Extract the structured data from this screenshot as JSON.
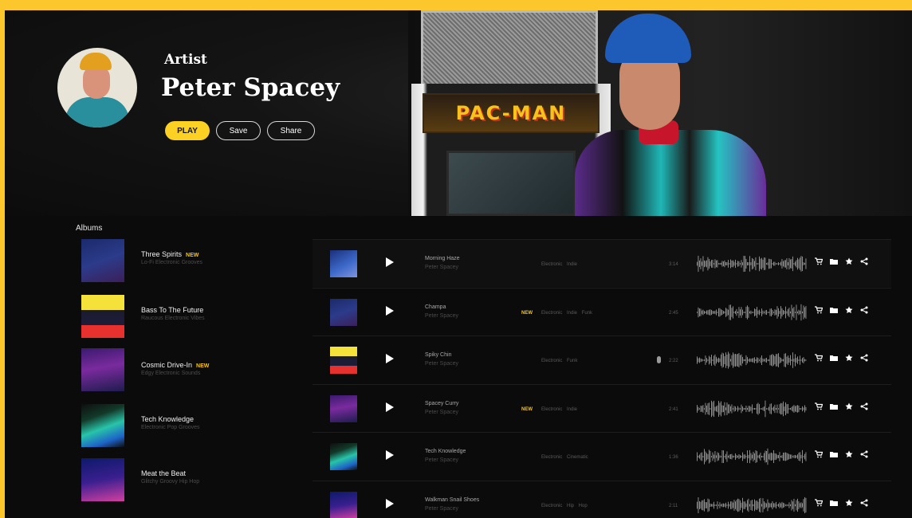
{
  "hero": {
    "label": "Artist",
    "title": "Peter Spacey",
    "play_label": "PLAY",
    "save_label": "Save",
    "share_label": "Share",
    "arcade_marquee": "PAC-MAN"
  },
  "albums": {
    "heading": "Albums",
    "new_badge": "NEW",
    "items": [
      {
        "title": "Three Spirits",
        "subtitle": "Lo-Fi Electronic Grooves",
        "new": true
      },
      {
        "title": "Bass To The Future",
        "subtitle": "Raucous Electronic Vibes",
        "new": false
      },
      {
        "title": "Cosmic Drive-In",
        "subtitle": "Edgy Electronic Sounds",
        "new": true
      },
      {
        "title": "Tech Knowledge",
        "subtitle": "Electronic Pop Grooves",
        "new": false
      },
      {
        "title": "Meat the Beat",
        "subtitle": "Glitchy Groovy Hip Hop",
        "new": false
      }
    ]
  },
  "tracks": {
    "new_badge": "NEW",
    "items": [
      {
        "title": "Morning Haze",
        "artist": "Peter Spacey",
        "new": false,
        "tags": "Electronic Indie",
        "duration": "3:14",
        "vocal": false
      },
      {
        "title": "Champa",
        "artist": "Peter Spacey",
        "new": true,
        "tags": "Electronic Indie Funk",
        "duration": "2:45",
        "vocal": false
      },
      {
        "title": "Spiky Chin",
        "artist": "Peter Spacey",
        "new": false,
        "tags": "Electronic Funk",
        "duration": "2:22",
        "vocal": true
      },
      {
        "title": "Spacey Curry",
        "artist": "Peter Spacey",
        "new": true,
        "tags": "Electronic Indie",
        "duration": "2:41",
        "vocal": false
      },
      {
        "title": "Tech Knowledge",
        "artist": "Peter Spacey",
        "new": false,
        "tags": "Electronic Cinematic",
        "duration": "1:36",
        "vocal": false
      },
      {
        "title": "Walkman Snail Shoes",
        "artist": "Peter Spacey",
        "new": false,
        "tags": "Electronic Hip Hop",
        "duration": "2:11",
        "vocal": false
      }
    ]
  },
  "colors": {
    "frame": "#fcc62d",
    "background": "#0b0b0b",
    "accent": "#fdd123",
    "new_badge": "#f5c518"
  },
  "icons": {
    "track_actions": [
      "cart-icon",
      "folder-icon",
      "star-icon",
      "share-icon"
    ]
  }
}
